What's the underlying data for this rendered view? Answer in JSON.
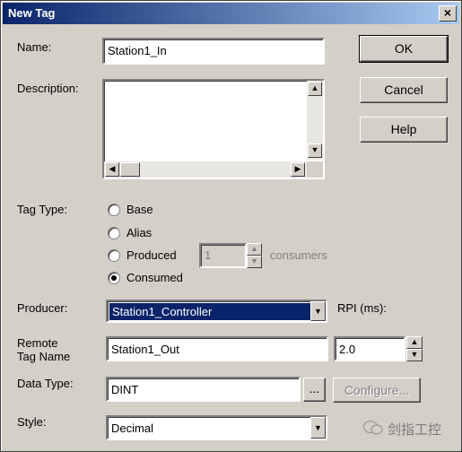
{
  "window": {
    "title": "New Tag",
    "close_glyph": "×"
  },
  "fields": {
    "name": {
      "label": "Name:",
      "value": "Station1_In"
    },
    "description": {
      "label": "Description:",
      "value": ""
    },
    "producer": {
      "label": "Producer:",
      "value": "Station1_Controller"
    },
    "remote_tag_name": {
      "label_line1": "Remote",
      "label_line2": "Tag Name",
      "value": "Station1_Out"
    },
    "data_type": {
      "label": "Data Type:",
      "value": "DINT",
      "browse_label": "...",
      "configure_label": "Configure..."
    },
    "style": {
      "label": "Style:",
      "value": "Decimal"
    },
    "rpi": {
      "label": "RPI (ms):",
      "value": "2.0"
    }
  },
  "tag_type": {
    "label": "Tag Type:",
    "options": [
      {
        "label": "Base",
        "selected": false
      },
      {
        "label": "Alias",
        "selected": false
      },
      {
        "label": "Produced",
        "selected": false
      },
      {
        "label": "Consumed",
        "selected": true
      }
    ],
    "consumers_value": "1",
    "consumers_label": "consumers"
  },
  "buttons": {
    "ok": "OK",
    "cancel": "Cancel",
    "help": "Help"
  },
  "watermark": {
    "text": "剑指工控"
  }
}
